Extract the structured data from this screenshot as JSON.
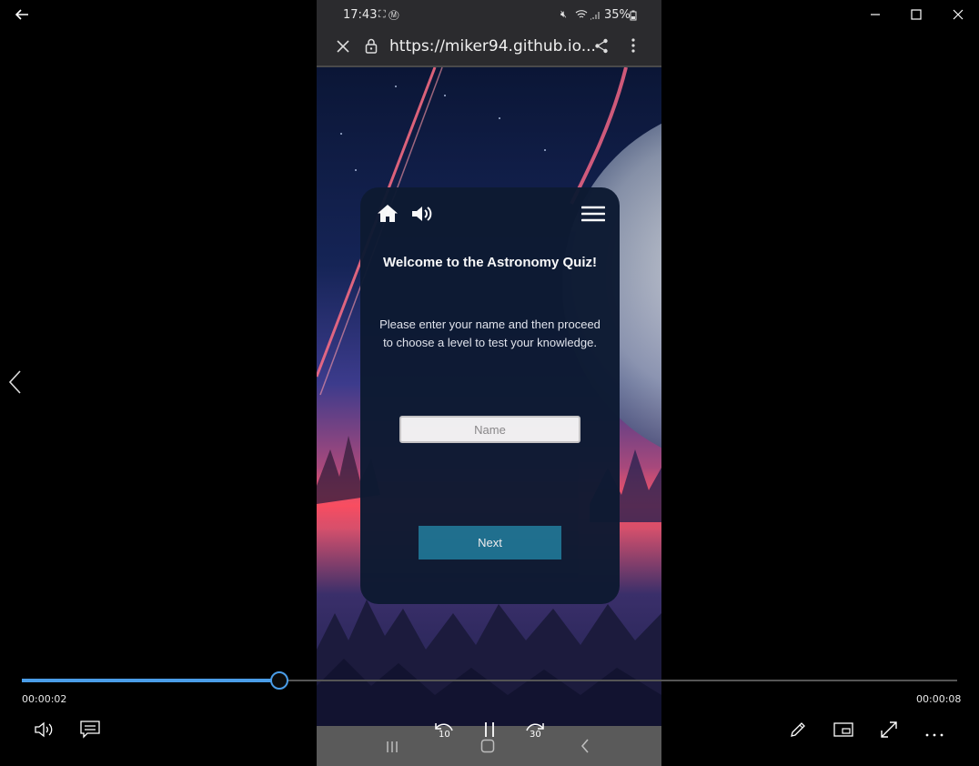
{
  "window": {
    "back_icon": "arrow-left-icon",
    "minimize_icon": "minimize-icon",
    "maximize_icon": "maximize-icon",
    "close_icon": "close-icon",
    "prev_icon": "chevron-left-icon"
  },
  "phone": {
    "status": {
      "time": "17:43",
      "battery": "35%"
    },
    "browser": {
      "url": "https://miker94.github.io..."
    },
    "quiz": {
      "title": "Welcome to the Astronomy Quiz!",
      "instructions": "Please enter your name and then proceed to choose a level to test your knowledge.",
      "name_placeholder": "Name",
      "next_label": "Next"
    }
  },
  "player": {
    "current_time": "00:00:02",
    "total_time": "00:00:08",
    "progress": 0.275,
    "accent": "#4a9de8",
    "rewind_label": "10",
    "forward_label": "30"
  }
}
